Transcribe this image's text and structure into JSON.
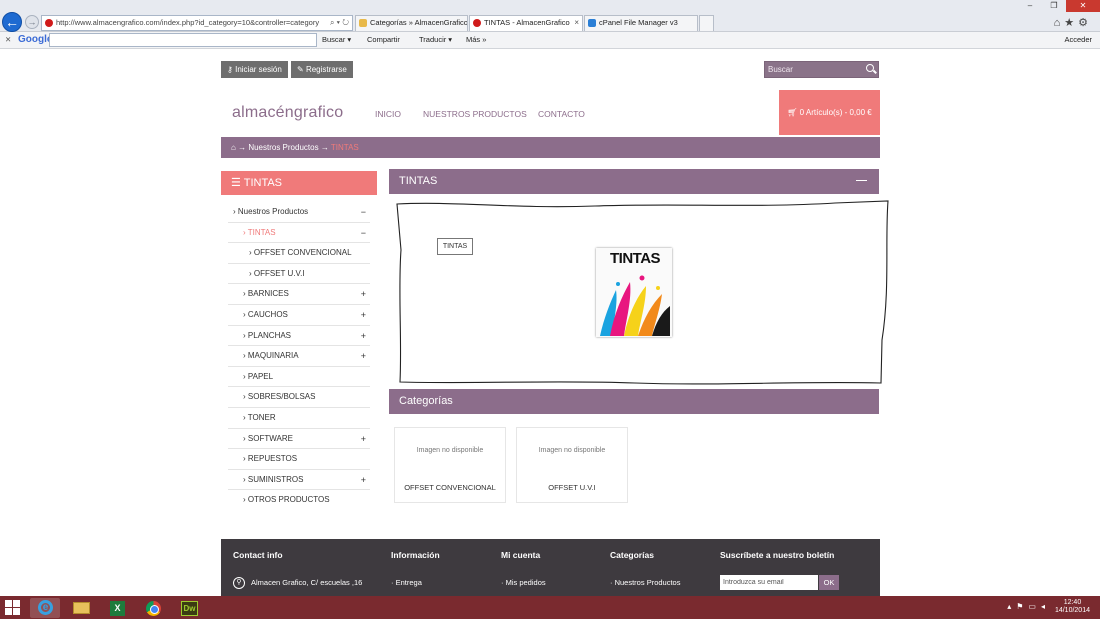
{
  "browser": {
    "address": "http://www.almacengrafico.com/index.php?id_category=10&controller=category",
    "tabs": [
      {
        "label": "Categorías » AlmacenGrafico"
      },
      {
        "label": "TINTAS - AlmacenGrafico"
      },
      {
        "label": "cPanel File Manager v3"
      }
    ],
    "toolbar": {
      "google": "Google",
      "buscar": "Buscar ▾",
      "compartir": "Compartir",
      "traducir": "Traducir ▾",
      "mas": "Más »",
      "acceder": "Acceder"
    }
  },
  "header": {
    "login_label": "Iniciar sesión",
    "register_label": "Registrarse",
    "search_placeholder": "Buscar",
    "logo": "almacéngrafico",
    "nav": [
      "INICIO",
      "NUESTROS PRODUCTOS",
      "CONTACTO"
    ],
    "cart": "0 Artículo(s) - 0,00 €"
  },
  "breadcrumb": {
    "home_arrow": "→",
    "parent": "Nuestros Productos",
    "sep": "→",
    "current": "TINTAS"
  },
  "sidebar": {
    "title": "TINTAS",
    "items": [
      {
        "label": "Nuestros Productos",
        "toggle": "−"
      },
      {
        "label": "TINTAS",
        "toggle": "−"
      },
      {
        "label": "OFFSET CONVENCIONAL",
        "toggle": ""
      },
      {
        "label": "OFFSET U.V.I",
        "toggle": ""
      },
      {
        "label": "BARNICES",
        "toggle": "+"
      },
      {
        "label": "CAUCHOS",
        "toggle": "+"
      },
      {
        "label": "PLANCHAS",
        "toggle": "+"
      },
      {
        "label": "MAQUINARIA",
        "toggle": "+"
      },
      {
        "label": "PAPEL",
        "toggle": ""
      },
      {
        "label": "SOBRES/BOLSAS",
        "toggle": ""
      },
      {
        "label": "TONER",
        "toggle": ""
      },
      {
        "label": "SOFTWARE",
        "toggle": "+"
      },
      {
        "label": "REPUESTOS",
        "toggle": ""
      },
      {
        "label": "SUMINISTROS",
        "toggle": "+"
      },
      {
        "label": "OTROS PRODUCTOS",
        "toggle": ""
      }
    ]
  },
  "main": {
    "title": "TINTAS",
    "tag": "TINTAS",
    "image_text": "TINTAS",
    "categories_title": "Categorías",
    "categories": [
      {
        "noimg": "Imagen no disponible",
        "name": "OFFSET CONVENCIONAL"
      },
      {
        "noimg": "Imagen no disponible",
        "name": "OFFSET U.V.I"
      }
    ]
  },
  "footer": {
    "contact_title": "Contact info",
    "contact_address": "Almacen Grafico, C/ escuelas ,16",
    "info_title": "Información",
    "info_link": "Entrega",
    "account_title": "Mi cuenta",
    "account_link": "Mis pedidos",
    "categories_title": "Categorías",
    "categories_link": "Nuestros Productos",
    "newsletter_title": "Suscríbete a nuestro boletín",
    "newsletter_placeholder": "Introduzca su email",
    "newsletter_ok": "OK"
  },
  "taskbar": {
    "time": "12:40",
    "date": "14/10/2014"
  },
  "colors": {
    "purple": "#8c6d8b",
    "salmon": "#f07a7a",
    "footer_bg": "#3e3a3f",
    "taskbar": "#7a2a2f"
  }
}
